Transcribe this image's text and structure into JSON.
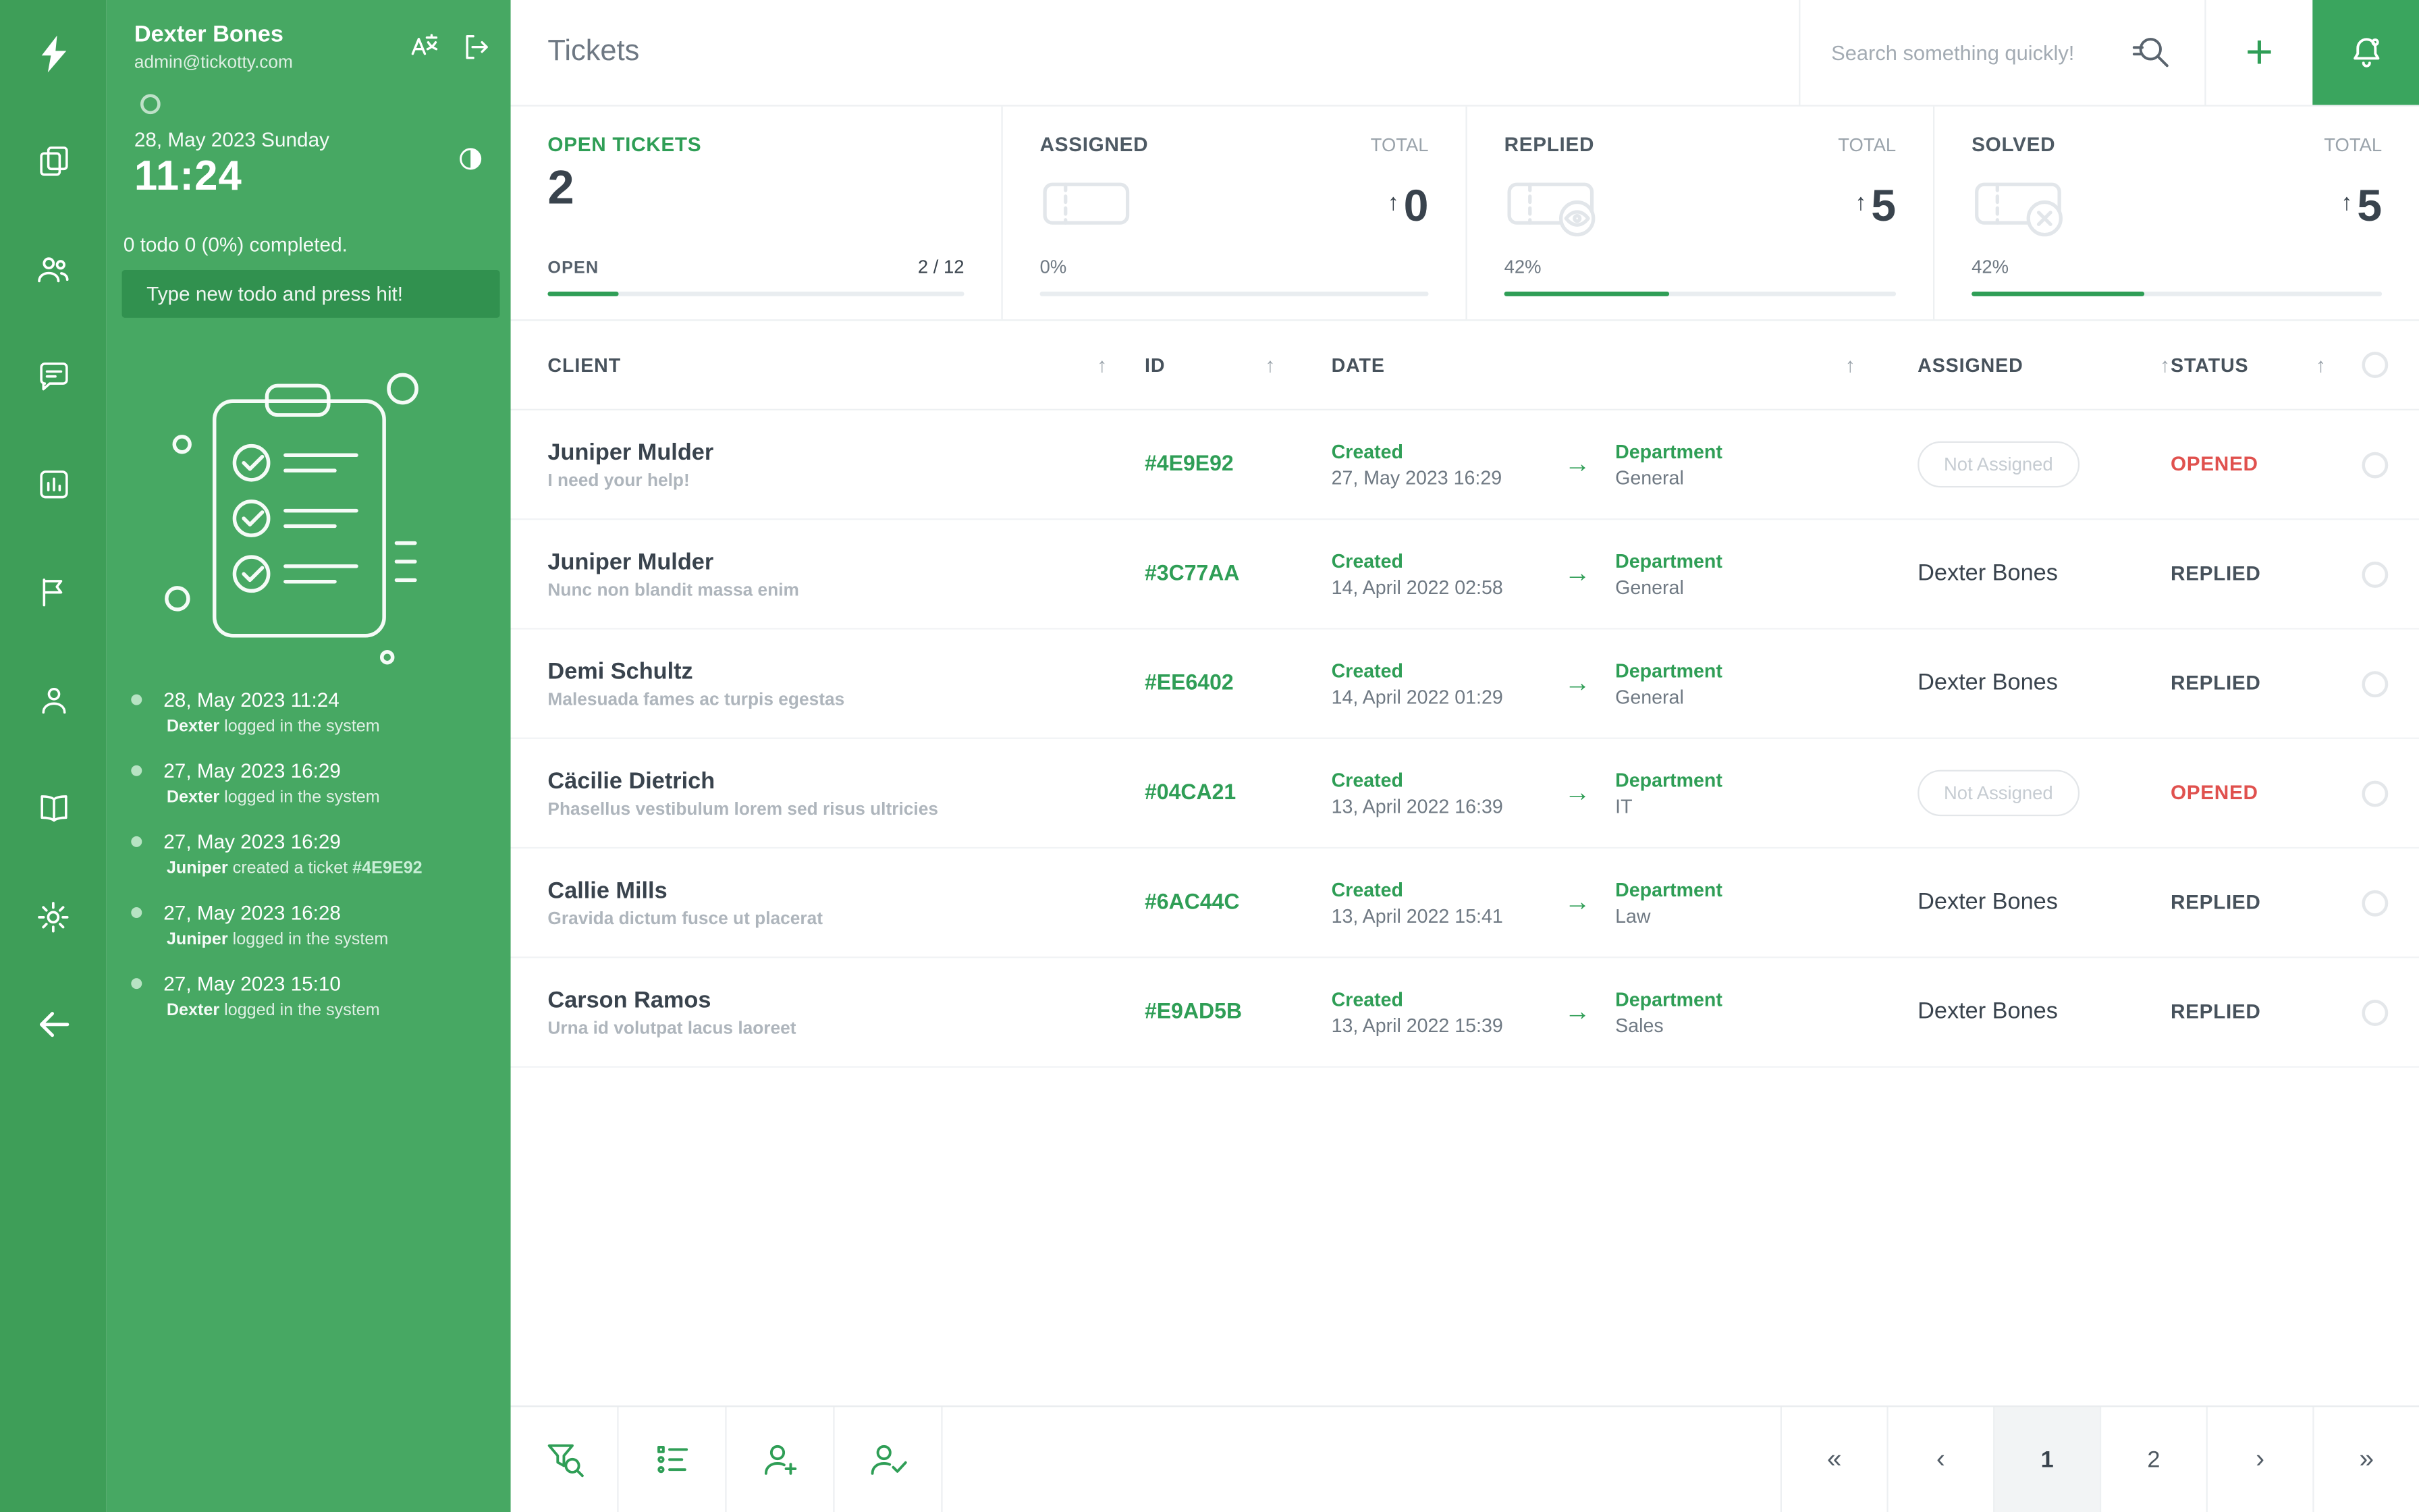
{
  "colors": {
    "accent": "#2f9e56",
    "rail_bg": "#3e9e58",
    "sidebar_bg": "#47a863",
    "bell_bg": "#3aa55e",
    "status_open_red": "#e0514e"
  },
  "rail": {
    "logo_icon": "lightning-bolt-icon",
    "icon_names": [
      "notes-icon",
      "team-icon",
      "chat-icon",
      "bar-chart-icon",
      "flag-icon",
      "person-icon",
      "book-icon",
      "gear-icon",
      "back-arrow-icon"
    ]
  },
  "sidebar": {
    "user": {
      "name": "Dexter Bones",
      "email": "admin@tickotty.com"
    },
    "header_icons": [
      "translate-icon",
      "logout-icon"
    ],
    "date_line": "28, May 2023 Sunday",
    "time": "11:24",
    "theme_icon": "contrast-icon",
    "todo_summary": "0 todo 0 (0%) completed.",
    "todo_placeholder": "Type new todo and press hit!",
    "activity": [
      {
        "date": "28, May 2023 11:24",
        "name": "Dexter",
        "action": "logged in the system",
        "ticket": ""
      },
      {
        "date": "27, May 2023 16:29",
        "name": "Dexter",
        "action": "logged in the system",
        "ticket": ""
      },
      {
        "date": "27, May 2023 16:29",
        "name": "Juniper",
        "action": "created a ticket",
        "ticket": "#4E9E92"
      },
      {
        "date": "27, May 2023 16:28",
        "name": "Juniper",
        "action": "logged in the system",
        "ticket": ""
      },
      {
        "date": "27, May 2023 15:10",
        "name": "Dexter",
        "action": "logged in the system",
        "ticket": ""
      }
    ]
  },
  "topbar": {
    "title": "Tickets",
    "search_placeholder": "Search something quickly!"
  },
  "stats": {
    "open": {
      "title": "OPEN TICKETS",
      "big": "2",
      "label": "OPEN",
      "fraction": "2 / 12",
      "progress_pct": 17
    },
    "assigned": {
      "title": "ASSIGNED",
      "total_label": "TOTAL",
      "count": "0",
      "percent": "0%",
      "progress_pct": 0,
      "icon": "ticket-icon"
    },
    "replied": {
      "title": "REPLIED",
      "total_label": "TOTAL",
      "count": "5",
      "percent": "42%",
      "progress_pct": 42,
      "icon": "ticket-eye-icon"
    },
    "solved": {
      "title": "SOLVED",
      "total_label": "TOTAL",
      "count": "5",
      "percent": "42%",
      "progress_pct": 42,
      "icon": "ticket-x-icon"
    }
  },
  "table": {
    "headers": {
      "client": "CLIENT",
      "id": "ID",
      "date": "DATE",
      "assigned": "ASSIGNED",
      "status": "STATUS"
    },
    "labels": {
      "created": "Created",
      "department": "Department"
    },
    "rows": [
      {
        "client": "Juniper Mulder",
        "subject": "I need your help!",
        "id": "#4E9E92",
        "created": "27, May 2023 16:29",
        "department": "General",
        "assigned": "Not Assigned",
        "assigned_badge": true,
        "status": "OPENED",
        "status_color": "red"
      },
      {
        "client": "Juniper Mulder",
        "subject": "Nunc non blandit massa enim",
        "id": "#3C77AA",
        "created": "14, April 2022 02:58",
        "department": "General",
        "assigned": "Dexter Bones",
        "assigned_badge": false,
        "status": "REPLIED",
        "status_color": "dark"
      },
      {
        "client": "Demi Schultz",
        "subject": "Malesuada fames ac turpis egestas",
        "id": "#EE6402",
        "created": "14, April 2022 01:29",
        "department": "General",
        "assigned": "Dexter Bones",
        "assigned_badge": false,
        "status": "REPLIED",
        "status_color": "dark"
      },
      {
        "client": "Cäcilie Dietrich",
        "subject": "Phasellus vestibulum lorem sed risus ultricies",
        "id": "#04CA21",
        "created": "13, April 2022 16:39",
        "department": "IT",
        "assigned": "Not Assigned",
        "assigned_badge": true,
        "status": "OPENED",
        "status_color": "red"
      },
      {
        "client": "Callie Mills",
        "subject": "Gravida dictum fusce ut placerat",
        "id": "#6AC44C",
        "created": "13, April 2022 15:41",
        "department": "Law",
        "assigned": "Dexter Bones",
        "assigned_badge": false,
        "status": "REPLIED",
        "status_color": "dark"
      },
      {
        "client": "Carson Ramos",
        "subject": "Urna id volutpat lacus laoreet",
        "id": "#E9AD5B",
        "created": "13, April 2022 15:39",
        "department": "Sales",
        "assigned": "Dexter Bones",
        "assigned_badge": false,
        "status": "REPLIED",
        "status_color": "dark"
      }
    ]
  },
  "footer": {
    "tool_icons": [
      "filter-search-icon",
      "list-icon",
      "add-user-icon",
      "assign-user-icon"
    ],
    "pagination": {
      "first": "«",
      "prev": "‹",
      "page1": "1",
      "page2": "2",
      "next": "›",
      "last": "»",
      "active": "1"
    }
  },
  "icons": {
    "arrow_right": "→",
    "sort_arrow": "↑",
    "up_arrow": "↑"
  }
}
